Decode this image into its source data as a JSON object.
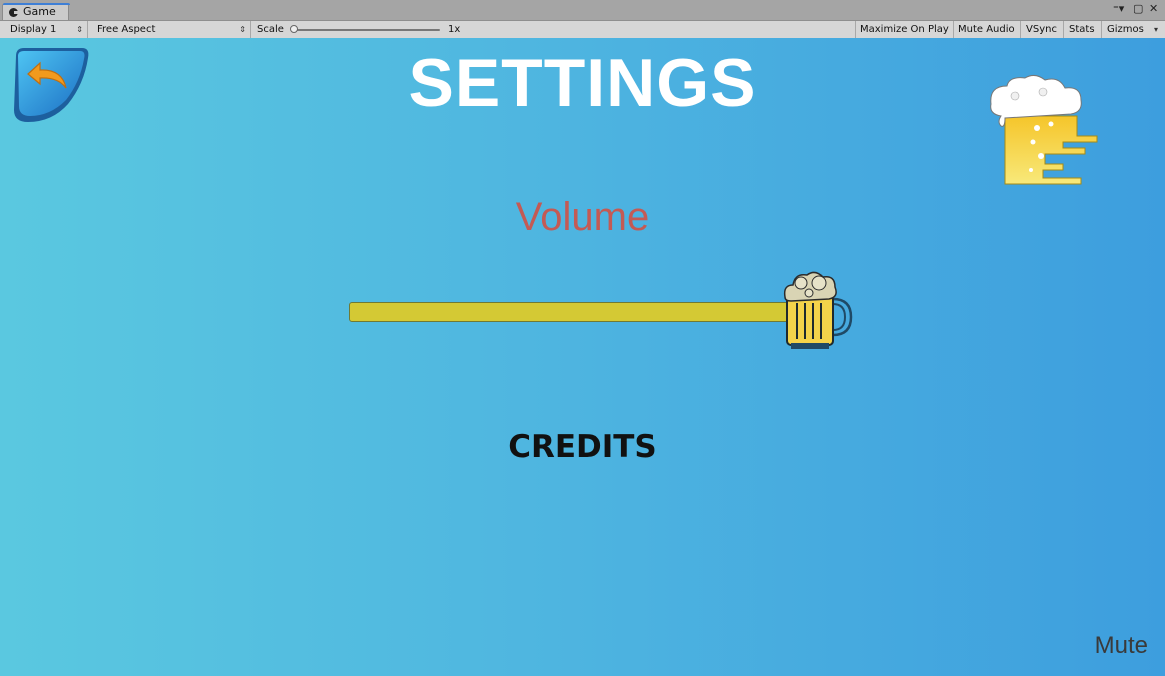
{
  "editor": {
    "tab_label": "Game",
    "display": "Display 1",
    "aspect": "Free Aspect",
    "scale_label": "Scale",
    "scale_value": "1x",
    "maximize_on_play": "Maximize On Play",
    "mute_audio": "Mute Audio",
    "vsync": "VSync",
    "stats": "Stats",
    "gizmos": "Gizmos"
  },
  "game": {
    "title": "SETTINGS",
    "volume_label": "Volume",
    "volume_level": 1.0,
    "credits_label": "CREDITS",
    "mute_label": "Mute",
    "background_colors": [
      "#5ac8e0",
      "#3d9ede"
    ],
    "slider_fill_color": "#d4c934"
  }
}
